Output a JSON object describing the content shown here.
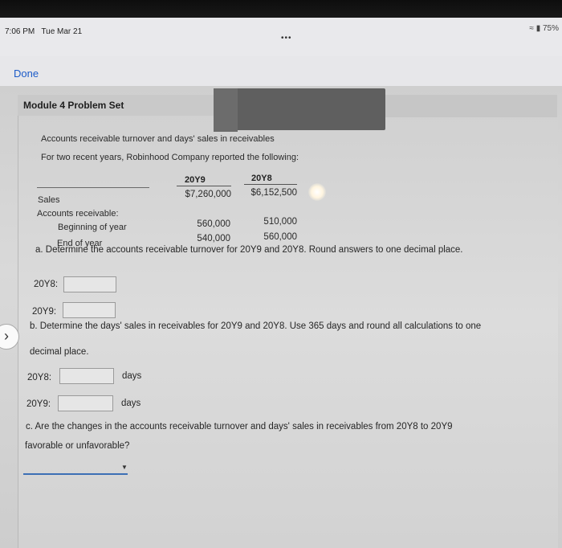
{
  "status": {
    "time": "7:06 PM",
    "date": "Tue Mar 21",
    "battery": "75%",
    "dots": "•••"
  },
  "nav": {
    "done_label": "Done"
  },
  "module": {
    "title": "Module 4 Problem Set"
  },
  "problem": {
    "heading": "Accounts receivable turnover and days' sales in receivables",
    "intro": "For two recent years, Robinhood Company reported the following:",
    "columns": [
      "20Y9",
      "20Y8"
    ],
    "rows": {
      "sales": {
        "label": "Sales",
        "y9": "$7,260,000",
        "y8": "$6,152,500"
      },
      "ar_label": "Accounts receivable:",
      "beginning": {
        "label": "Beginning of year",
        "y9": "560,000",
        "y8": "510,000"
      },
      "end": {
        "label": "End of year",
        "y9": "540,000",
        "y8": "560,000"
      }
    }
  },
  "part_a": {
    "question": "a. Determine the accounts receivable turnover for 20Y9 and 20Y8. Round answers to one decimal place.",
    "label_y8": "20Y8:",
    "label_y9": "20Y9:",
    "value_y8": "",
    "value_y9": ""
  },
  "part_b": {
    "question_line1": "b. Determine the days' sales in receivables for 20Y9 and 20Y8. Use 365 days and round all calculations to one",
    "question_line2": "decimal place.",
    "label_y8": "20Y8:",
    "label_y9": "20Y9:",
    "unit": "days",
    "value_y8": "",
    "value_y9": ""
  },
  "part_c": {
    "question_line1": "c. Are the changes in the accounts receivable turnover and days' sales in receivables from 20Y8 to 20Y9",
    "question_line2": "favorable or unfavorable?",
    "selected": ""
  },
  "icons": {
    "next": "chevron-right-icon",
    "dropdown": "caret-down-icon"
  }
}
